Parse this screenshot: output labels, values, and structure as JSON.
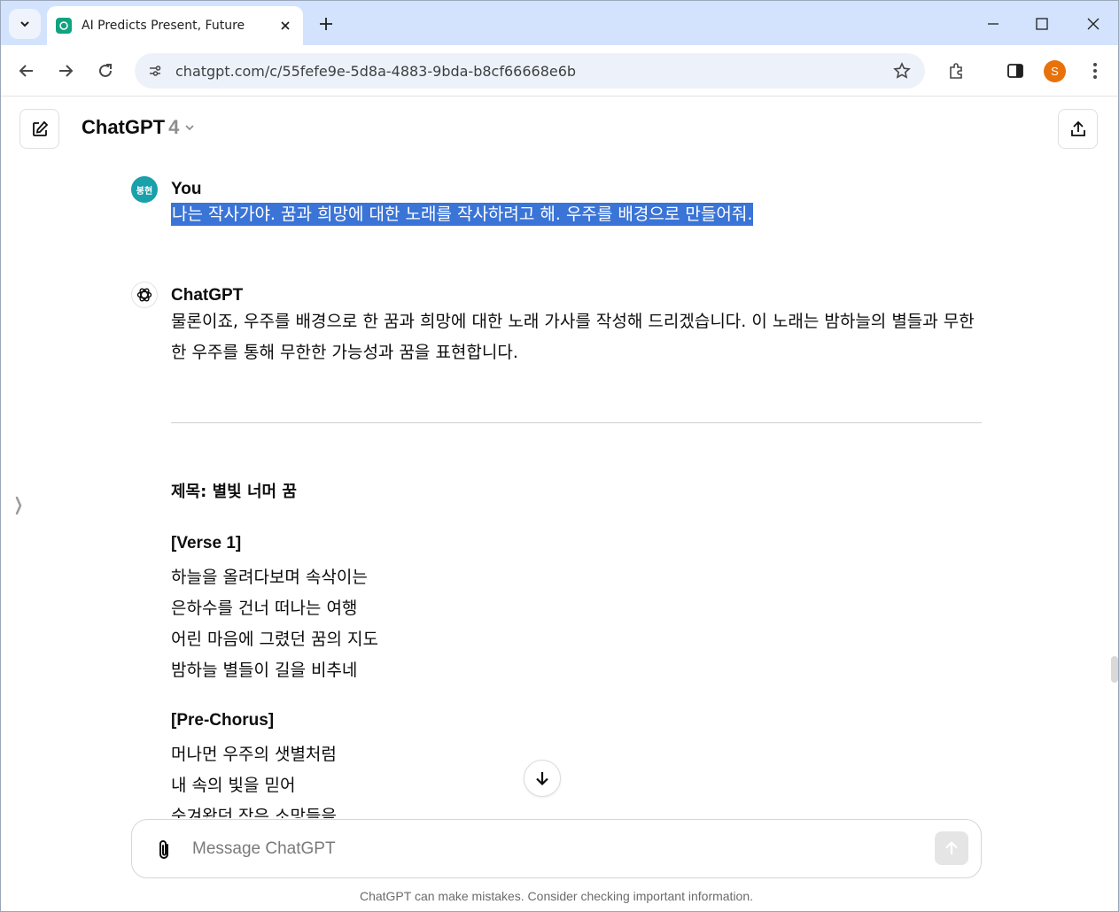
{
  "browser": {
    "tab_title": "AI Predicts Present, Future",
    "url": "chatgpt.com/c/55fefe9e-5d8a-4883-9bda-b8cf66668e6b",
    "profile_initial": "S",
    "icons": [
      "tab-search-icon",
      "favicon-icon",
      "close-icon",
      "plus-icon",
      "minimize-icon",
      "maximize-icon",
      "window-close-icon",
      "back-icon",
      "forward-icon",
      "reload-icon",
      "site-info-icon",
      "star-icon",
      "extensions-icon",
      "side-panel-icon",
      "more-icon"
    ]
  },
  "header": {
    "model_name": "ChatGPT",
    "model_version": "4"
  },
  "conversation": {
    "user": {
      "avatar_text": "봉현",
      "author": "You",
      "message": "나는 작사가야. 꿈과 희망에 대한 노래를 작사하려고 해. 우주를 배경으로 만들어줘."
    },
    "assistant": {
      "author": "ChatGPT",
      "intro": "물론이죠, 우주를 배경으로 한 꿈과 희망에 대한 노래 가사를 작성해 드리겠습니다. 이 노래는 밤하늘의 별들과 무한한 우주를 통해 무한한 가능성과 꿈을 표현합니다.",
      "song_title": "제목: 별빛 너머 꿈",
      "verse1_label": "[Verse 1]",
      "verse1": [
        "하늘을 올려다보며 속삭이는",
        "은하수를 건너 떠나는 여행",
        "어린 마음에 그렸던 꿈의 지도",
        "밤하늘 별들이 길을 비추네"
      ],
      "prechorus_label": "[Pre-Chorus]",
      "prechorus": [
        "머나먼 우주의 샛별처럼",
        "내 속의 빛을 믿어",
        "숨겨왔던 작은 소망들을"
      ]
    }
  },
  "composer": {
    "placeholder": "Message ChatGPT"
  },
  "footer": {
    "disclaimer": "ChatGPT can make mistakes. Consider checking important information."
  },
  "colors": {
    "tabstrip": "#d3e3fd",
    "selection": "#3a74d7",
    "user_avatar": "#19a0ab",
    "profile": "#e8710a"
  }
}
